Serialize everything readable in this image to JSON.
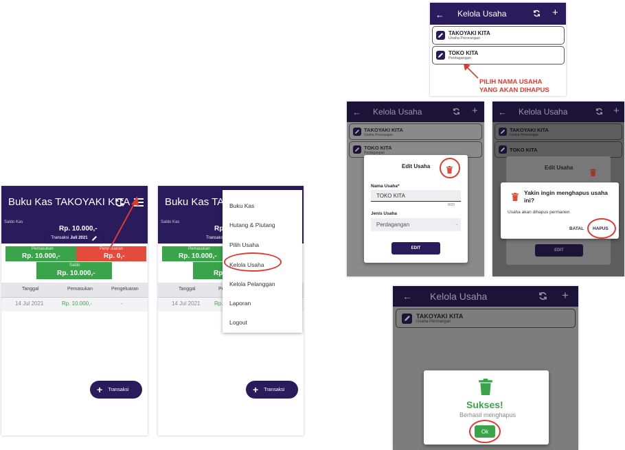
{
  "screen1": {
    "title": "Buku Kas TAKOYAKI KITA",
    "saldo_kas_label": "Saldo Kas",
    "saldo_kas_value": "Rp. 10.000,-",
    "transaksi_prefix": "Transaksi",
    "transaksi_month": "Juli 2021",
    "pemasukan_label": "Pemasukan",
    "pemasukan_value": "Rp. 10.000,-",
    "pengeluaran_label": "Pengeluaran",
    "pengeluaran_value": "Rp. 0,-",
    "saldo_label": "Saldo",
    "saldo_value": "Rp. 10.000,-",
    "columns": [
      "Tanggal",
      "Pemasukan",
      "Pengeluaran"
    ],
    "row": [
      "14 Jul 2021",
      "Rp. 10.000,-",
      "-"
    ],
    "fab_label": "Transaksi"
  },
  "screen2": {
    "title": "Buku Kas TAKOY",
    "saldo_kas_label": "Saldo Kas",
    "saldo_kas_value": "Rp.",
    "transaksi_prefix": "Transaksi",
    "pemasukan_label": "Pemasukan",
    "pemasukan_value": "Rp. 10.000,-",
    "saldo_value": "Rp.",
    "columns": [
      "Tanggal",
      "Pe"
    ],
    "row": [
      "14 Jul 2021",
      "Rp."
    ],
    "fab_label": "Transaksi",
    "menu": [
      "Buku Kas",
      "Hutang & Piutang",
      "Pilih Usaha",
      "Kelola Usaha",
      "Kelola Pelanggan",
      "Laporan",
      "Logout"
    ]
  },
  "kelola": {
    "title": "Kelola Usaha",
    "items": [
      {
        "name": "TAKOYAKI KITA",
        "type": "Usaha Perorangan"
      },
      {
        "name": "TOKO KITA",
        "type": "Perdagangan"
      }
    ],
    "annotation_line1": "PILIH NAMA USAHA",
    "annotation_line2": "YANG AKAN DIHAPUS"
  },
  "edit_dialog": {
    "title": "Edit Usaha",
    "nama_label": "Nama Usaha*",
    "nama_value": "TOKO KITA",
    "counter": "9/20",
    "jenis_label": "Jenis Usaha",
    "jenis_value": "Perdagangan",
    "edit_button": "EDIT"
  },
  "confirm_dialog": {
    "title": "Yakin ingin menghapus usaha ini?",
    "message": "Usaha akan dihapus permanen",
    "batal": "BATAL",
    "hapus": "HAPUS",
    "bg_title": "Edit Usaha",
    "bg_edit": "EDIT"
  },
  "success_dialog": {
    "title": "Sukses!",
    "message": "Berhasil menghapus",
    "ok": "Ok"
  },
  "colors": {
    "primary": "#2a1b5c",
    "green": "#3aa44a",
    "red": "#e54b3c",
    "annotation": "#e03a2f"
  }
}
